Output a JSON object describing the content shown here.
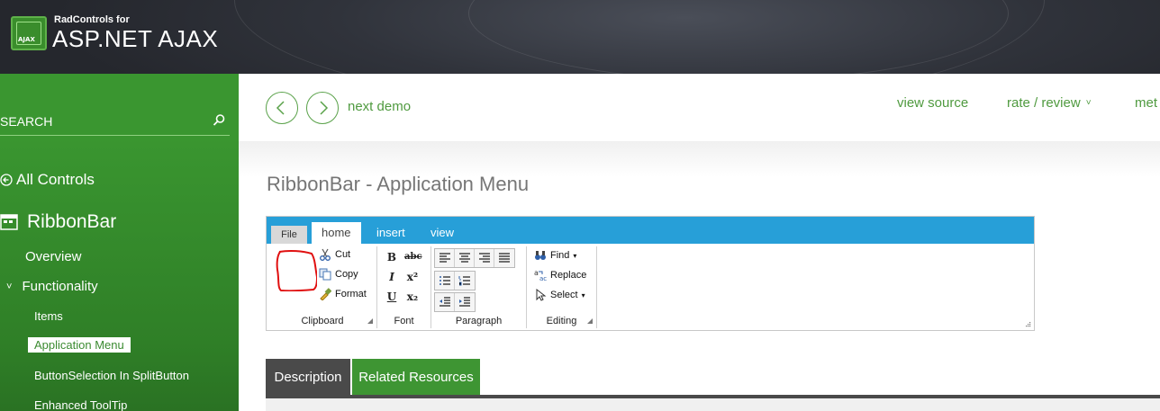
{
  "header": {
    "brand_small": "RadControls for",
    "brand_big": "ASP.NET AJAX",
    "logo_tag": "AJAX"
  },
  "sidebar": {
    "search_label": "SEARCH",
    "all_controls": "All Controls",
    "control_name": "RibbonBar",
    "items": [
      {
        "label": "Overview"
      },
      {
        "label": "Functionality"
      },
      {
        "label": "Items"
      },
      {
        "label": "Application Menu"
      },
      {
        "label": "ButtonSelection In SplitButton"
      },
      {
        "label": "Enhanced ToolTip"
      }
    ]
  },
  "nav": {
    "next_demo": "next demo",
    "view_source": "view source",
    "rate_review": "rate / review",
    "more": "met"
  },
  "page": {
    "title": "RibbonBar - Application Menu"
  },
  "ribbon": {
    "file_tab": "File",
    "tabs": [
      {
        "label": "home"
      },
      {
        "label": "insert"
      },
      {
        "label": "view"
      }
    ],
    "groups": {
      "clipboard": {
        "label": "Clipboard",
        "buttons": [
          "Cut",
          "Copy",
          "Format"
        ]
      },
      "font": {
        "label": "Font",
        "buttons": [
          "B",
          "abc",
          "I",
          "x²",
          "U",
          "x₂"
        ]
      },
      "paragraph": {
        "label": "Paragraph"
      },
      "editing": {
        "label": "Editing",
        "buttons": [
          "Find",
          "Replace",
          "Select"
        ]
      }
    }
  },
  "bottom_tabs": {
    "description": "Description",
    "related": "Related Resources"
  },
  "colors": {
    "sidebar_green": "#3a9630",
    "ribbon_blue": "#279fd8",
    "link_green": "#4f9a3f",
    "annotation_red": "#e01010"
  }
}
